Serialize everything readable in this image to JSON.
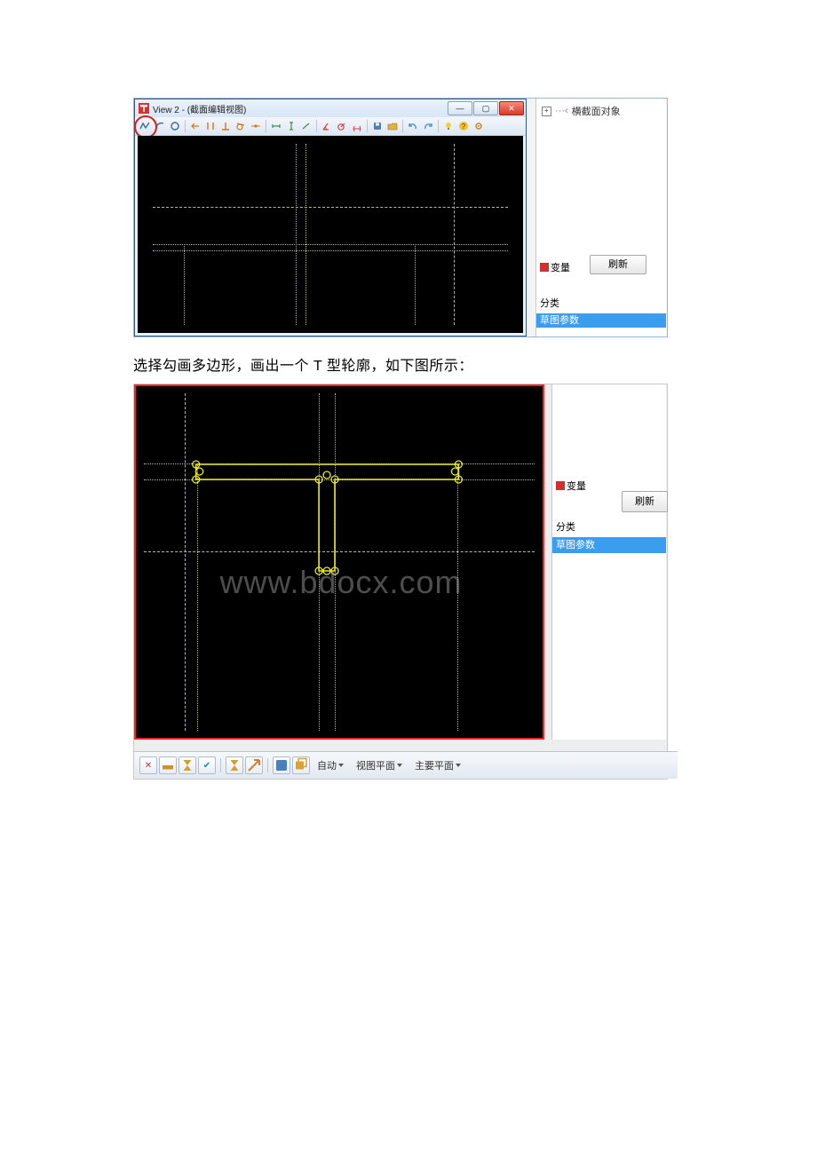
{
  "screenshot1": {
    "window_title": "View 2 - (截面编辑视图)",
    "tree_item": "横截面对象",
    "variable_label": "变量",
    "refresh_label": "刷新",
    "category_label": "分类",
    "section_band": "草图参数"
  },
  "caption": "选择勾画多边形，画出一个 T 型轮廓，如下图所示：",
  "screenshot2": {
    "variable_label": "变量",
    "refresh_label": "刷新",
    "category_label": "分类",
    "section_band": "草图参数",
    "bottom_dropdown_1": "自动",
    "bottom_dropdown_2": "视图平面",
    "bottom_dropdown_3": "主要平面"
  },
  "watermark": "www.bdocx.com"
}
